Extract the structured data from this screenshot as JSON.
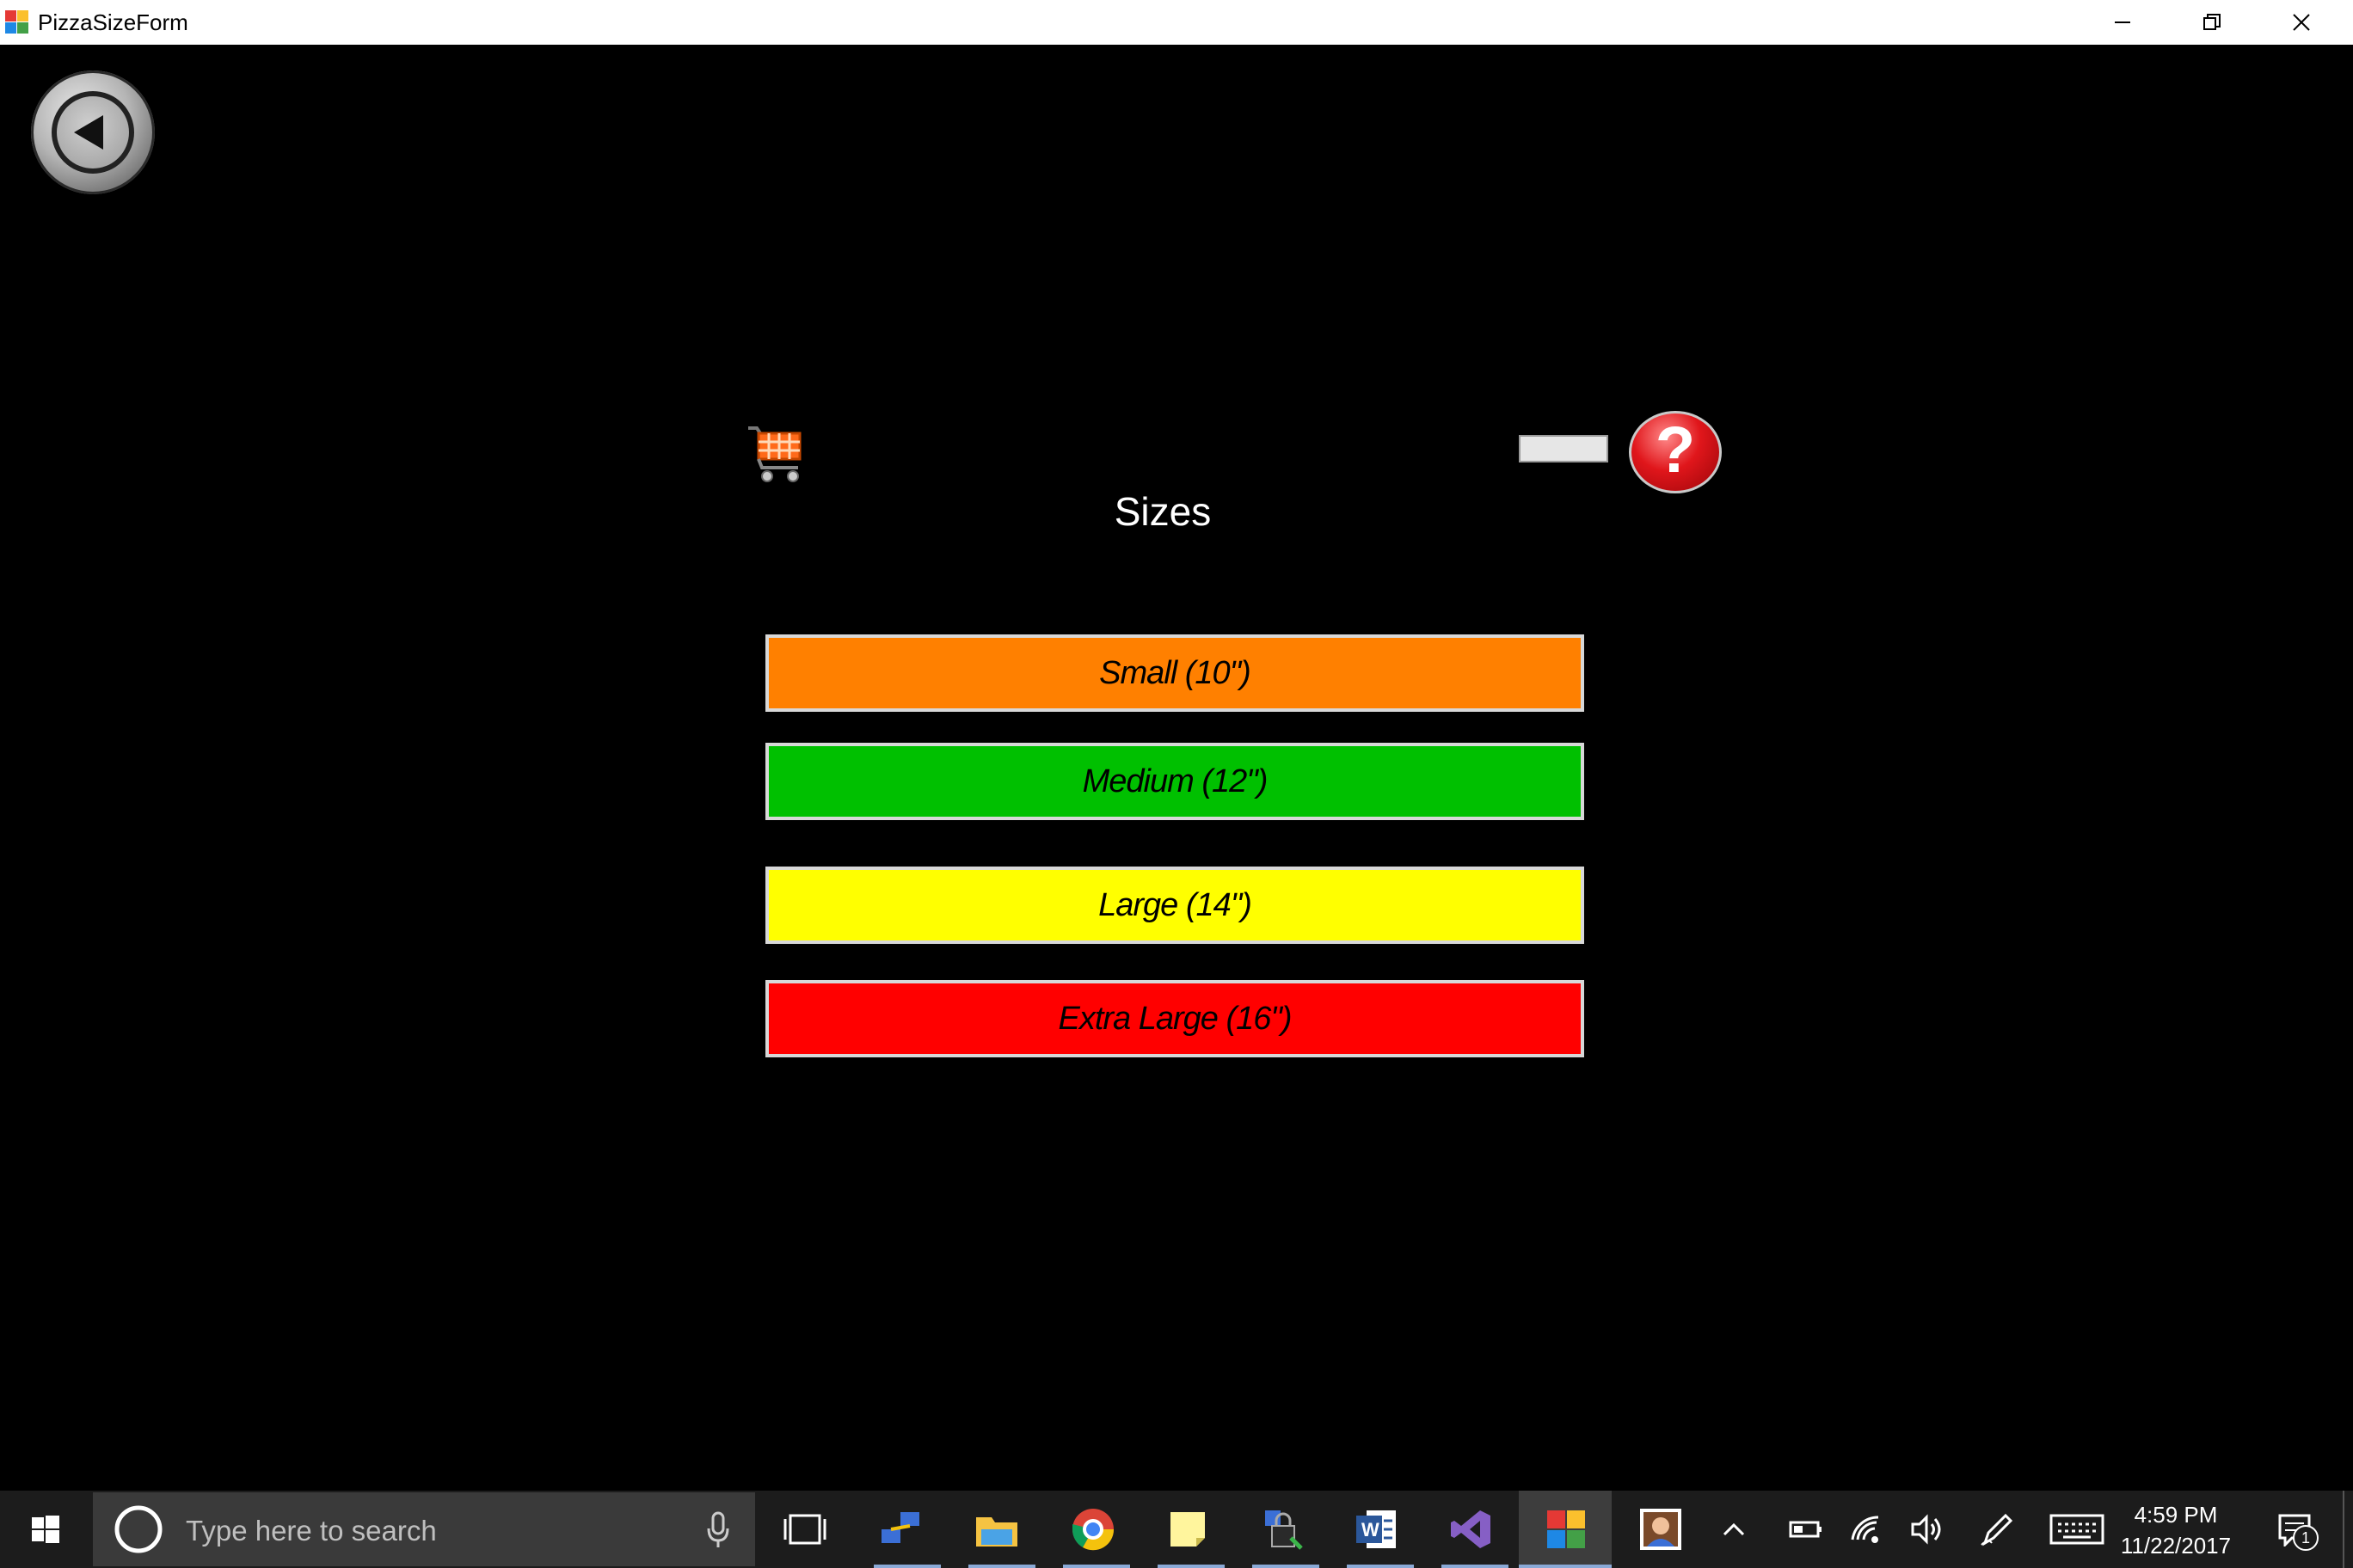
{
  "window": {
    "title": "PizzaSizeForm",
    "controls": [
      "minimize",
      "restore",
      "close"
    ]
  },
  "form": {
    "heading": "Sizes",
    "back_icon": "back-arrow-icon",
    "cart_icon": "shopping-cart-icon",
    "help_label": "?",
    "sizes": [
      {
        "label": "Small (10\")",
        "color": "#ff8000"
      },
      {
        "label": "Medium (12\")",
        "color": "#00c000"
      },
      {
        "label": "Large (14\")",
        "color": "#ffff00"
      },
      {
        "label": "Extra Large (16\")",
        "color": "#ff0000"
      }
    ]
  },
  "taskbar": {
    "search_placeholder": "Type here to search",
    "time": "4:59 PM",
    "date": "11/22/2017",
    "notification_count": "1",
    "pinned_apps": [
      "start-icon",
      "cortana-icon",
      "task-view-icon",
      "network-app-icon",
      "file-explorer-icon",
      "chrome-icon",
      "sticky-notes-icon",
      "security-app-icon",
      "word-icon",
      "visual-studio-icon",
      "pizza-app-icon",
      "photo-app-icon"
    ]
  }
}
